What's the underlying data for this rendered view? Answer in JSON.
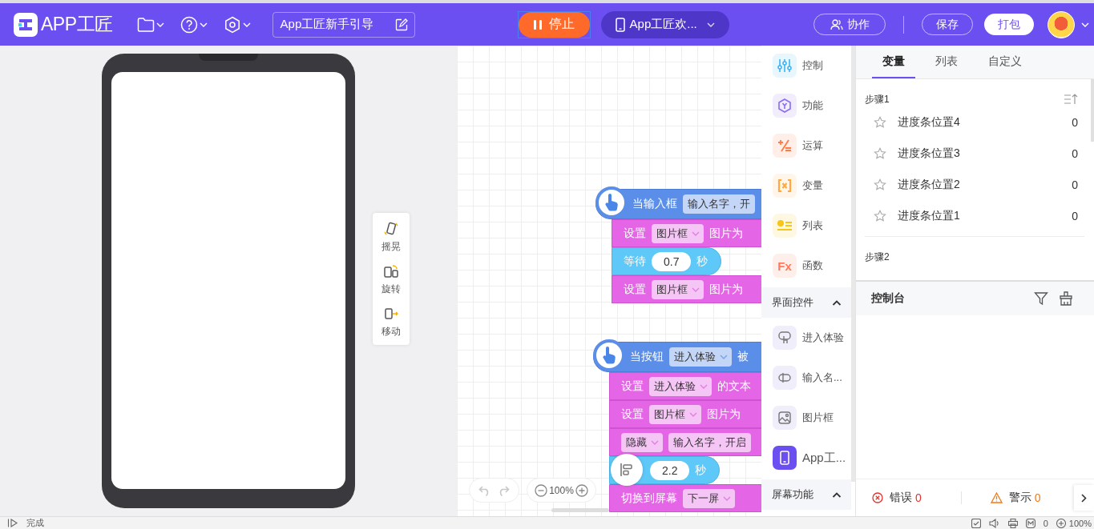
{
  "header": {
    "logo": "APP工匠",
    "project_title": "App工匠新手引导",
    "run_button": {
      "label": "停止",
      "running": true
    },
    "screen_select": "App工匠欢...",
    "buttons": [
      {
        "label": "协作",
        "kind": "collab"
      },
      {
        "label": "保存",
        "kind": "outline"
      },
      {
        "label": "打包",
        "kind": "primary"
      }
    ]
  },
  "phone_tools": [
    {
      "label": "摇晃",
      "kind": "shake"
    },
    {
      "label": "旋转",
      "kind": "rotate"
    },
    {
      "label": "移动",
      "kind": "move"
    }
  ],
  "scripts": [
    {
      "hat": [
        {
          "kind": "label",
          "text": "当输入框"
        },
        {
          "kind": "field",
          "text": "输入名字，开"
        }
      ],
      "rows": [
        {
          "kind": "action",
          "parts": [
            {
              "kind": "label",
              "text": "设置"
            },
            {
              "kind": "dropdown",
              "text": "图片框"
            },
            {
              "kind": "label",
              "text": "图片为"
            }
          ]
        },
        {
          "kind": "wait",
          "parts": [
            {
              "kind": "label",
              "text": "等待"
            },
            {
              "kind": "number",
              "text": "0.7"
            },
            {
              "kind": "label",
              "text": "秒"
            }
          ]
        },
        {
          "kind": "action",
          "parts": [
            {
              "kind": "label",
              "text": "设置"
            },
            {
              "kind": "dropdown",
              "text": "图片框"
            },
            {
              "kind": "label",
              "text": "图片为"
            }
          ]
        }
      ]
    },
    {
      "hat": [
        {
          "kind": "label",
          "text": "当按钮"
        },
        {
          "kind": "dropdown",
          "text": "进入体验"
        },
        {
          "kind": "label",
          "text": "被"
        }
      ],
      "rows": [
        {
          "kind": "action",
          "parts": [
            {
              "kind": "label",
              "text": "设置"
            },
            {
              "kind": "dropdown",
              "text": "进入体验"
            },
            {
              "kind": "label",
              "text": "的文本"
            }
          ]
        },
        {
          "kind": "action",
          "parts": [
            {
              "kind": "label",
              "text": "设置"
            },
            {
              "kind": "dropdown",
              "text": "图片框"
            },
            {
              "kind": "label",
              "text": "图片为"
            }
          ]
        },
        {
          "kind": "action",
          "parts": [
            {
              "kind": "dropdown",
              "text": "隐藏"
            },
            {
              "kind": "field",
              "text": "输入名字，开启"
            }
          ]
        },
        {
          "kind": "wait",
          "parts": [
            {
              "kind": "number",
              "text": "2.2"
            },
            {
              "kind": "label",
              "text": "秒"
            }
          ]
        },
        {
          "kind": "screen",
          "parts": [
            {
              "kind": "label",
              "text": "切换到屏幕"
            },
            {
              "kind": "dropdown",
              "text": "下一屏"
            }
          ]
        }
      ]
    }
  ],
  "canvas_controls": {
    "zoom": "100%"
  },
  "palette": {
    "categories": [
      {
        "label": "控制",
        "kind": "control",
        "color": "#3fb4f2"
      },
      {
        "label": "功能",
        "kind": "function",
        "color": "#8b6cf0"
      },
      {
        "label": "运算",
        "kind": "math",
        "color": "#ff7a45"
      },
      {
        "label": "变量",
        "kind": "variable",
        "color": "#ffa940"
      },
      {
        "label": "列表",
        "kind": "list",
        "color": "#f5c518"
      },
      {
        "label": "函数",
        "kind": "fx",
        "color": "#ff7a5c",
        "icon_text": "Fx"
      }
    ],
    "sections": [
      {
        "title": "界面控件",
        "expanded": true,
        "items": [
          {
            "label": "进入体验",
            "kind": "button"
          },
          {
            "label": "输入名...",
            "kind": "input"
          },
          {
            "label": "图片框",
            "kind": "image"
          },
          {
            "label": "App工...",
            "kind": "screen"
          }
        ]
      },
      {
        "title": "屏幕功能",
        "expanded": true
      }
    ]
  },
  "right_panel": {
    "tabs": [
      {
        "label": "变量",
        "selected": true
      },
      {
        "label": "列表",
        "selected": false
      },
      {
        "label": "自定义",
        "selected": false
      }
    ],
    "groups": [
      {
        "title": "步骤1",
        "variables": [
          {
            "name": "进度条位置4",
            "value": "0",
            "starred": false
          },
          {
            "name": "进度条位置3",
            "value": "0",
            "starred": false
          },
          {
            "name": "进度条位置2",
            "value": "0",
            "starred": false
          },
          {
            "name": "进度条位置1",
            "value": "0",
            "starred": false
          }
        ]
      },
      {
        "title": "步骤2"
      }
    ],
    "console": {
      "title": "控制台",
      "errors": {
        "label": "错误",
        "count": "0"
      },
      "warnings": {
        "label": "警示",
        "count": "0"
      }
    }
  },
  "status_bar": {
    "status": "完成",
    "count": "0",
    "zoom": "100%"
  }
}
